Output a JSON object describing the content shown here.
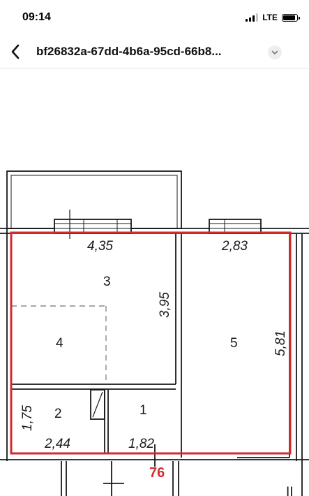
{
  "status": {
    "time": "09:14",
    "network": "LTE",
    "signal_bars_active": 3,
    "signal_bars_total": 4
  },
  "nav": {
    "back_icon": "chevron-left-icon",
    "title": "bf26832a-67dd-4b6a-95cd-66b8...",
    "menu_icon": "chevron-down-icon"
  },
  "floorplan": {
    "rooms": [
      {
        "number": "3",
        "width": "4,35",
        "length": "3,95"
      },
      {
        "number": "4"
      },
      {
        "number": "5",
        "width": "2,83",
        "length": "5,81"
      },
      {
        "number": "2",
        "width": "2,44",
        "length": "1,75"
      },
      {
        "number": "1",
        "width": "1,82"
      }
    ],
    "marker": "76",
    "corner_mark": "II"
  },
  "colors": {
    "highlight": "#d62b2b",
    "walls": "#1a1a1a",
    "marker": "#d62b2b"
  }
}
